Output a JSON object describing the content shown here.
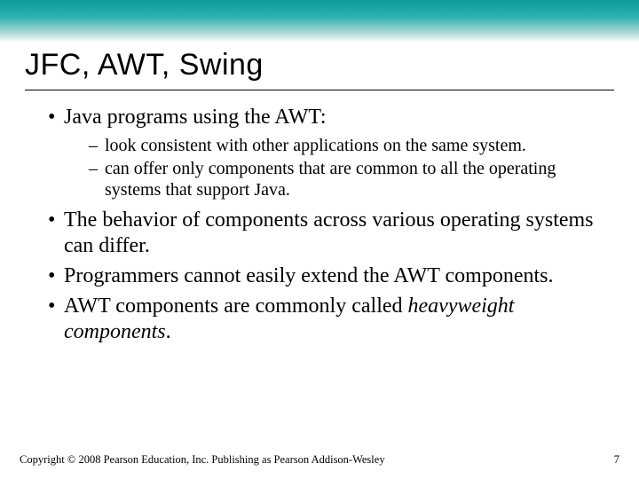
{
  "slide": {
    "title": "JFC, AWT, Swing",
    "bullets": [
      {
        "text": "Java programs using the AWT:",
        "sub": [
          "look consistent with other applications on the same system.",
          "can offer only components that are common to all the operating systems that support Java."
        ]
      },
      {
        "text": "The behavior of components across various operating systems can differ."
      },
      {
        "text": "Programmers cannot easily extend the AWT components."
      },
      {
        "text_prefix": "AWT components are commonly called ",
        "text_italic": "heavyweight components",
        "text_suffix": "."
      }
    ],
    "footer": {
      "copyright": "Copyright © 2008 Pearson Education, Inc. Publishing as Pearson Addison-Wesley",
      "page": "7"
    }
  }
}
